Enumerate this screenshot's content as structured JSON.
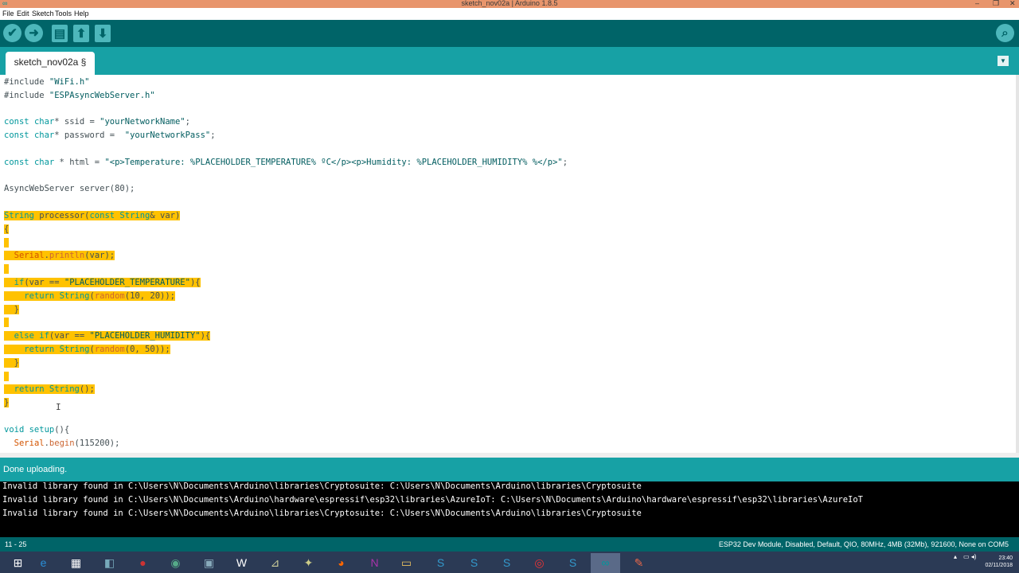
{
  "window": {
    "title": "sketch_nov02a | Arduino 1.8.5",
    "minimize": "–",
    "maximize": "❐",
    "close": "✕"
  },
  "menu": [
    "File",
    "Edit",
    "Sketch",
    "Tools",
    "Help"
  ],
  "toolbar": {
    "verify_icon": "✔",
    "upload_icon": "➜",
    "new_icon": "▤",
    "open_icon": "⬆",
    "save_icon": "⬇",
    "serial_icon": "⌕"
  },
  "tab": {
    "label": "sketch_nov02a §",
    "menu_icon": "▼"
  },
  "status": {
    "message": "Done uploading."
  },
  "console": {
    "lines": [
      "Invalid library found in C:\\Users\\N\\Documents\\Arduino\\libraries\\Cryptosuite: C:\\Users\\N\\Documents\\Arduino\\libraries\\Cryptosuite",
      "Invalid library found in C:\\Users\\N\\Documents\\Arduino\\hardware\\espressif\\esp32\\libraries\\AzureIoT: C:\\Users\\N\\Documents\\Arduino\\hardware\\espressif\\esp32\\libraries\\AzureIoT",
      "Invalid library found in C:\\Users\\N\\Documents\\Arduino\\libraries\\Cryptosuite: C:\\Users\\N\\Documents\\Arduino\\libraries\\Cryptosuite"
    ]
  },
  "footer": {
    "line_range": "11 - 25",
    "board": "ESP32 Dev Module, Disabled, Default, QIO, 80MHz, 4MB (32Mb), 921600, None on COM5"
  },
  "taskbar": {
    "icons": [
      "⊞",
      "e",
      "▦",
      "◧",
      "●",
      "◉",
      "▣",
      "W",
      "⊿",
      "✦",
      "◕",
      "N",
      "▭",
      "S",
      "S",
      "S",
      "◎",
      "S",
      "∞",
      "✎"
    ],
    "tray_arrow": "▴",
    "tray_icons": "▭ ◂)",
    "time": "23:40",
    "date": "02/11/2018"
  },
  "code": [
    {
      "segs": [
        {
          "t": "#include ",
          "c": ""
        },
        {
          "t": "\"WiFi.h\"",
          "c": "str"
        }
      ]
    },
    {
      "segs": [
        {
          "t": "#include ",
          "c": ""
        },
        {
          "t": "\"ESPAsyncWebServer.h\"",
          "c": "str"
        }
      ]
    },
    {
      "segs": [
        {
          "t": "",
          "c": ""
        }
      ]
    },
    {
      "segs": [
        {
          "t": "const ",
          "c": "kw"
        },
        {
          "t": "char",
          "c": "kw"
        },
        {
          "t": "* ssid = ",
          "c": ""
        },
        {
          "t": "\"yourNetworkName\"",
          "c": "str"
        },
        {
          "t": ";",
          "c": ""
        }
      ]
    },
    {
      "segs": [
        {
          "t": "const ",
          "c": "kw"
        },
        {
          "t": "char",
          "c": "kw"
        },
        {
          "t": "* password =  ",
          "c": ""
        },
        {
          "t": "\"yourNetworkPass\"",
          "c": "str"
        },
        {
          "t": ";",
          "c": ""
        }
      ]
    },
    {
      "segs": [
        {
          "t": "",
          "c": ""
        }
      ]
    },
    {
      "segs": [
        {
          "t": "const ",
          "c": "kw"
        },
        {
          "t": "char",
          "c": "kw"
        },
        {
          "t": " * html = ",
          "c": ""
        },
        {
          "t": "\"<p>Temperature: %PLACEHOLDER_TEMPERATURE% ºC</p><p>Humidity: %PLACEHOLDER_HUMIDITY% %</p>\"",
          "c": "str"
        },
        {
          "t": ";",
          "c": ""
        }
      ]
    },
    {
      "segs": [
        {
          "t": "",
          "c": ""
        }
      ]
    },
    {
      "segs": [
        {
          "t": "AsyncWebServer server(80);",
          "c": ""
        }
      ]
    },
    {
      "segs": [
        {
          "t": "",
          "c": ""
        }
      ]
    },
    {
      "hl": true,
      "segs": [
        {
          "t": "String",
          "c": "kw"
        },
        {
          "t": " processor(",
          "c": ""
        },
        {
          "t": "const ",
          "c": "kw"
        },
        {
          "t": "String",
          "c": "kw"
        },
        {
          "t": "& var)",
          "c": ""
        }
      ]
    },
    {
      "hl": true,
      "segs": [
        {
          "t": "{",
          "c": ""
        }
      ]
    },
    {
      "hl": true,
      "segs": [
        {
          "t": " ",
          "c": ""
        }
      ]
    },
    {
      "hl": true,
      "segs": [
        {
          "t": "  ",
          "c": ""
        },
        {
          "t": "Serial",
          "c": "orange"
        },
        {
          "t": ".",
          "c": ""
        },
        {
          "t": "println",
          "c": "type"
        },
        {
          "t": "(var);",
          "c": ""
        }
      ]
    },
    {
      "hl": true,
      "segs": [
        {
          "t": " ",
          "c": ""
        }
      ]
    },
    {
      "hl": true,
      "segs": [
        {
          "t": "  ",
          "c": ""
        },
        {
          "t": "if",
          "c": "kw"
        },
        {
          "t": "(var == ",
          "c": ""
        },
        {
          "t": "\"PLACEHOLDER_TEMPERATURE\"",
          "c": "str"
        },
        {
          "t": "){",
          "c": ""
        }
      ]
    },
    {
      "hl": true,
      "segs": [
        {
          "t": "    ",
          "c": ""
        },
        {
          "t": "return ",
          "c": "kw"
        },
        {
          "t": "String",
          "c": "kw"
        },
        {
          "t": "(",
          "c": ""
        },
        {
          "t": "random",
          "c": "type"
        },
        {
          "t": "(10, 20));",
          "c": ""
        }
      ]
    },
    {
      "hl": true,
      "segs": [
        {
          "t": "  }",
          "c": ""
        }
      ]
    },
    {
      "hl": true,
      "segs": [
        {
          "t": " ",
          "c": ""
        }
      ]
    },
    {
      "hl": true,
      "segs": [
        {
          "t": "  ",
          "c": ""
        },
        {
          "t": "else if",
          "c": "kw"
        },
        {
          "t": "(var == ",
          "c": ""
        },
        {
          "t": "\"PLACEHOLDER_HUMIDITY\"",
          "c": "str"
        },
        {
          "t": "){",
          "c": ""
        }
      ]
    },
    {
      "hl": true,
      "segs": [
        {
          "t": "    ",
          "c": ""
        },
        {
          "t": "return ",
          "c": "kw"
        },
        {
          "t": "String",
          "c": "kw"
        },
        {
          "t": "(",
          "c": ""
        },
        {
          "t": "random",
          "c": "type"
        },
        {
          "t": "(0, 50));",
          "c": ""
        }
      ]
    },
    {
      "hl": true,
      "segs": [
        {
          "t": "  }",
          "c": ""
        }
      ]
    },
    {
      "hl": true,
      "segs": [
        {
          "t": " ",
          "c": ""
        }
      ]
    },
    {
      "hl": true,
      "segs": [
        {
          "t": "  ",
          "c": ""
        },
        {
          "t": "return ",
          "c": "kw"
        },
        {
          "t": "String",
          "c": "kw"
        },
        {
          "t": "();",
          "c": ""
        }
      ]
    },
    {
      "hl": true,
      "segs": [
        {
          "t": "}",
          "c": ""
        }
      ]
    },
    {
      "segs": [
        {
          "t": "",
          "c": ""
        }
      ]
    },
    {
      "segs": [
        {
          "t": "void ",
          "c": "kw"
        },
        {
          "t": "setup",
          "c": "kw"
        },
        {
          "t": "(){",
          "c": ""
        }
      ]
    },
    {
      "segs": [
        {
          "t": "  ",
          "c": ""
        },
        {
          "t": "Serial",
          "c": "orange"
        },
        {
          "t": ".",
          "c": ""
        },
        {
          "t": "begin",
          "c": "type"
        },
        {
          "t": "(115200);",
          "c": ""
        }
      ]
    }
  ]
}
